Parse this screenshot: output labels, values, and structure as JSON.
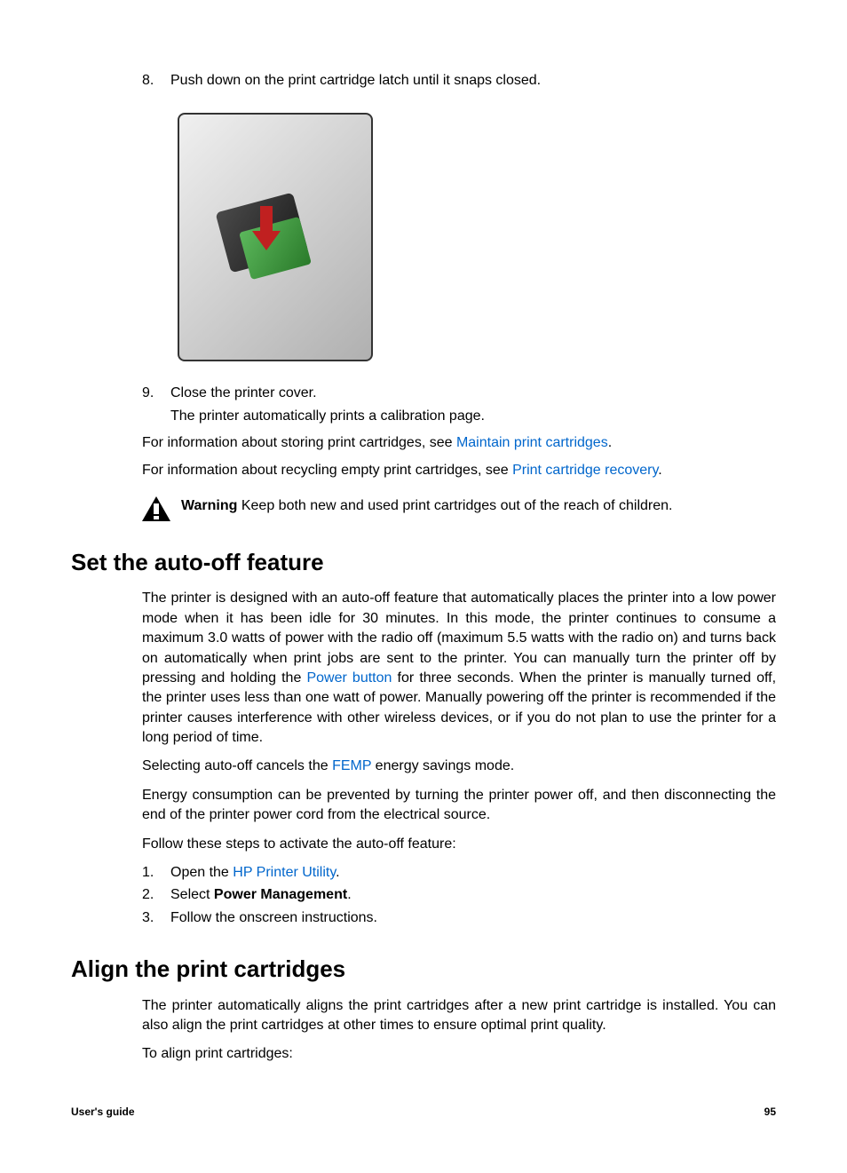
{
  "steps_cont": {
    "step8_num": "8.",
    "step8_text": "Push down on the print cartridge latch until it snaps closed.",
    "step9_num": "9.",
    "step9_text": "Close the printer cover.",
    "step9_sub": "The printer automatically prints a calibration page."
  },
  "storing_info_pre": "For information about storing print cartridges, see ",
  "storing_info_link": "Maintain print cartridges",
  "storing_info_post": ".",
  "recycling_info_pre": "For information about recycling empty print cartridges, see ",
  "recycling_info_link": "Print cartridge recovery",
  "recycling_info_post": ".",
  "warning_label": "Warning",
  "warning_text": " Keep both new and used print cartridges out of the reach of children.",
  "section_autooff": {
    "heading": "Set the auto-off feature",
    "para1_pre": "The printer is designed with an auto-off feature that automatically places the printer into a low power mode when it has been idle for 30 minutes. In this mode, the printer continues to consume a maximum 3.0 watts of power with the radio off (maximum 5.5 watts with the radio on) and turns back on automatically when print jobs are sent to the printer. You can manually turn the printer off by pressing and holding the ",
    "para1_link": "Power button",
    "para1_post": " for three seconds. When the printer is manually turned off, the printer uses less than one watt of power. Manually powering off the printer is recommended if the printer causes interference with other wireless devices, or if you do not plan to use the printer for a long period of time.",
    "para2_pre": "Selecting auto-off cancels the ",
    "para2_link": "FEMP",
    "para2_post": " energy savings mode.",
    "para3": "Energy consumption can be prevented by turning the printer power off, and then disconnecting the end of the printer power cord from the electrical source.",
    "para4": "Follow these steps to activate the auto-off feature:",
    "steps": {
      "n1": "1.",
      "t1_pre": "Open the ",
      "t1_link": "HP Printer Utility",
      "t1_post": ".",
      "n2": "2.",
      "t2_pre": "Select ",
      "t2_bold": "Power Management",
      "t2_post": ".",
      "n3": "3.",
      "t3": "Follow the onscreen instructions."
    }
  },
  "section_align": {
    "heading": "Align the print cartridges",
    "para1": "The printer automatically aligns the print cartridges after a new print cartridge is installed. You can also align the print cartridges at other times to ensure optimal print quality.",
    "para2": "To align print cartridges:"
  },
  "footer": {
    "left": "User's guide",
    "right": "95"
  }
}
